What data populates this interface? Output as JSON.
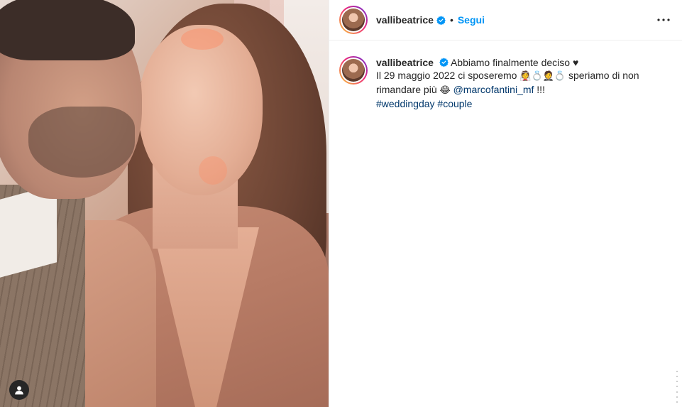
{
  "post": {
    "username": "vallibeatrice",
    "verified": true,
    "follow_label": "Segui",
    "separator": "•",
    "icons": {
      "verified": "verified-badge-icon",
      "more": "more-options-icon",
      "tag": "user-tag-icon"
    },
    "colors": {
      "link": "#00376b",
      "follow": "#0095f6",
      "verified": "#0095f6"
    }
  },
  "caption": {
    "username": "vallibeatrice",
    "line1": "Abbiamo finalmente deciso ♥",
    "line2_a": "Il 29 maggio 2022 ci sposeremo",
    "emojis": "👰💍🤵💍",
    "line2_b": "speriamo di non rimandare più",
    "laugh_emoji": "😂",
    "mention": "@marcofantini_mf",
    "tail": "!!!",
    "hashtags": [
      "#weddingday",
      "#couple"
    ]
  }
}
